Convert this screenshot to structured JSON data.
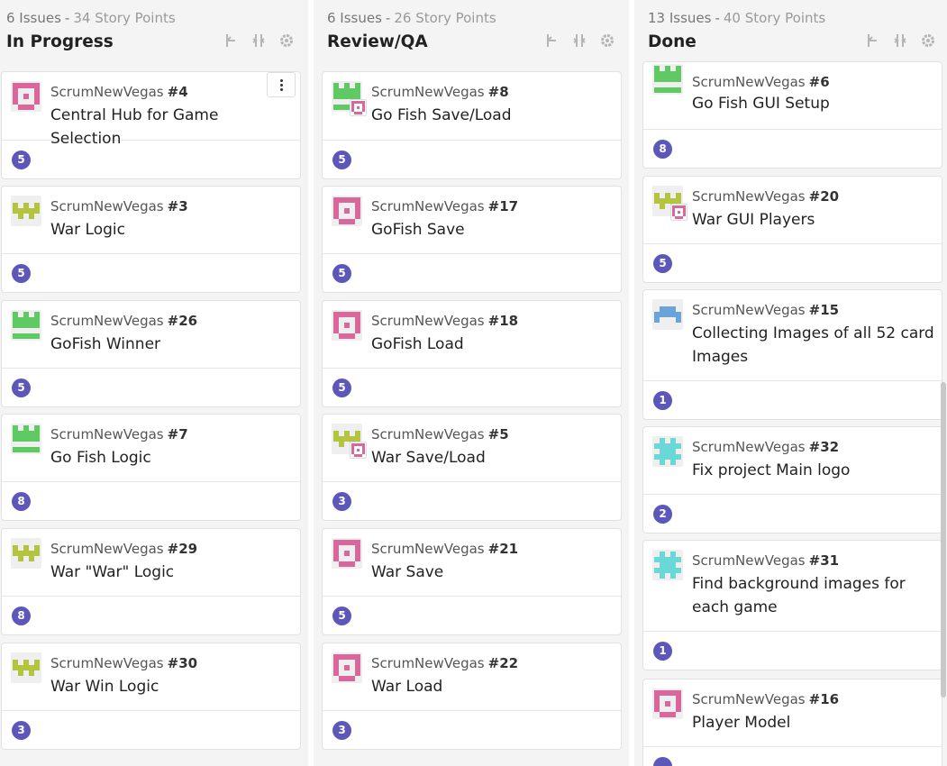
{
  "columns": [
    {
      "issues": "6 Issues",
      "points": "34 Story Points",
      "title": "In Progress",
      "cards": [
        {
          "repo": "ScrumNewVegas",
          "num": "#4",
          "title": "Central Hub for Game Selection",
          "points": "5",
          "avatar": "pink"
        },
        {
          "repo": "ScrumNewVegas",
          "num": "#3",
          "title": "War Logic",
          "points": "5",
          "avatar": "lime"
        },
        {
          "repo": "ScrumNewVegas",
          "num": "#26",
          "title": "GoFish Winner",
          "points": "5",
          "avatar": "green"
        },
        {
          "repo": "ScrumNewVegas",
          "num": "#7",
          "title": "Go Fish Logic",
          "points": "8",
          "avatar": "green"
        },
        {
          "repo": "ScrumNewVegas",
          "num": "#29",
          "title": "War \"War\" Logic",
          "points": "8",
          "avatar": "lime"
        },
        {
          "repo": "ScrumNewVegas",
          "num": "#30",
          "title": "War Win Logic",
          "points": "3",
          "avatar": "lime"
        }
      ]
    },
    {
      "issues": "6 Issues",
      "points": "26 Story Points",
      "title": "Review/QA",
      "cards": [
        {
          "repo": "ScrumNewVegas",
          "num": "#8",
          "title": "Go Fish Save/Load",
          "points": "5",
          "avatar": "green",
          "mini": "pink"
        },
        {
          "repo": "ScrumNewVegas",
          "num": "#17",
          "title": "GoFish Save",
          "points": "5",
          "avatar": "pink"
        },
        {
          "repo": "ScrumNewVegas",
          "num": "#18",
          "title": "GoFish Load",
          "points": "5",
          "avatar": "pink"
        },
        {
          "repo": "ScrumNewVegas",
          "num": "#5",
          "title": "War Save/Load",
          "points": "3",
          "avatar": "lime",
          "mini": "pink"
        },
        {
          "repo": "ScrumNewVegas",
          "num": "#21",
          "title": "War Save",
          "points": "5",
          "avatar": "pink"
        },
        {
          "repo": "ScrumNewVegas",
          "num": "#22",
          "title": "War Load",
          "points": "3",
          "avatar": "pink"
        }
      ]
    },
    {
      "issues": "13 Issues",
      "points": "40 Story Points",
      "title": "Done",
      "cards": [
        {
          "repo": "ScrumNewVegas",
          "num": "#6",
          "title": "Go Fish GUI Setup",
          "points": "8",
          "avatar": "green"
        },
        {
          "repo": "ScrumNewVegas",
          "num": "#20",
          "title": "War GUI Players",
          "points": "5",
          "avatar": "lime",
          "mini": "pink"
        },
        {
          "repo": "ScrumNewVegas",
          "num": "#15",
          "title": "Collecting Images of all 52 card Images",
          "points": "1",
          "avatar": "blue"
        },
        {
          "repo": "ScrumNewVegas",
          "num": "#32",
          "title": "Fix project Main logo",
          "points": "2",
          "avatar": "cyan"
        },
        {
          "repo": "ScrumNewVegas",
          "num": "#31",
          "title": "Find background images for each game",
          "points": "1",
          "avatar": "cyan"
        },
        {
          "repo": "ScrumNewVegas",
          "num": "#16",
          "title": "Player Model",
          "points": "",
          "avatar": "pink"
        }
      ]
    }
  ],
  "colors": {
    "points_badge": "#5c57b8",
    "avatar_pink": "#d9679b",
    "avatar_lime": "#b5c43f",
    "avatar_green": "#5fc963",
    "avatar_blue": "#6aa3d8",
    "avatar_cyan": "#69d8d6"
  },
  "icons": {
    "column_actions": [
      "collapse-left-icon",
      "collapse-column-icon",
      "settings-gear-icon"
    ],
    "card_menu": "more-options-icon"
  }
}
